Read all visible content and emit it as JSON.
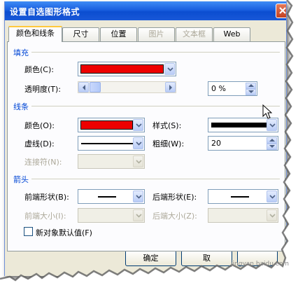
{
  "window": {
    "title": "设置自选图形格式"
  },
  "tabs": [
    {
      "label": "颜色和线条",
      "active": true,
      "disabled": false
    },
    {
      "label": "尺寸",
      "active": false,
      "disabled": false
    },
    {
      "label": "位置",
      "active": false,
      "disabled": false
    },
    {
      "label": "图片",
      "active": false,
      "disabled": true
    },
    {
      "label": "文本框",
      "active": false,
      "disabled": true
    },
    {
      "label": "Web",
      "active": false,
      "disabled": false
    }
  ],
  "fill": {
    "section": "填充",
    "color_label": "颜色(C):",
    "color": "#ee0000",
    "transparency_label": "透明度(T):",
    "transparency_value": "0 %"
  },
  "line": {
    "section": "线条",
    "color_label": "颜色(O):",
    "color": "#ee0000",
    "style_label": "样式(S):",
    "dash_label": "虚线(D):",
    "weight_label": "粗细(W):",
    "weight_value": "20",
    "connector_label": "连接符(N):"
  },
  "arrows": {
    "section": "箭头",
    "begin_style_label": "前端形状(B):",
    "end_style_label": "后端形状(E):",
    "begin_size_label": "前端大小(I):",
    "end_size_label": "后端大小(Z):"
  },
  "defaults_checkbox": {
    "label": "新对象默认值(F)",
    "checked": false
  },
  "buttons": {
    "ok": "确定",
    "cancel": "取"
  },
  "watermark": "jingyan.baidu.com",
  "colors": {
    "accent_blue": "#0046d5",
    "title_blue": "#0b4dd0",
    "swatch_red": "#ee0000"
  },
  "icons": [
    "close-icon",
    "chevron-down-icon",
    "arrow-left-icon",
    "arrow-right-icon",
    "spin-up-icon",
    "spin-down-icon",
    "mouse-cursor-icon"
  ]
}
